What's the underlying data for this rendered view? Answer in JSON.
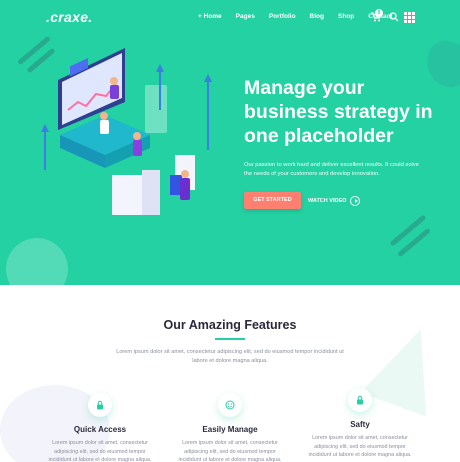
{
  "brand": {
    "logo": ".craxe.",
    "accent": "#23d1a3",
    "cta_color": "#ff8070"
  },
  "nav": {
    "items": [
      "+ Home",
      "Pages",
      "Portfolio",
      "Blog",
      "Shop",
      "Contact"
    ],
    "cart_count": "0",
    "icons": [
      "cart-icon",
      "search-icon",
      "grid-menu-icon"
    ]
  },
  "hero": {
    "title": "Manage your business strategy in one placeholder",
    "subtitle": "Our passion to work hard and deliver excellent results. It could solve the needs of your customers and develop innovation.",
    "cta_label": "GET STARTED",
    "video_label": "WATCH VIDEO"
  },
  "features": {
    "title": "Our Amazing Features",
    "description": "Lorem ipsum dolor sit amet, consectetur adipiscing elit, sed do eiusmod tempor incididunt ut labore et dolore magna aliqua.",
    "cards": [
      {
        "title": "Quick Access",
        "icon": "lock-icon",
        "text": "Lorem ipsum dolor sit amet, consectetur adipiscing elit, sed do eiusmod tempor incididunt ut labore et dolore magna aliqua."
      },
      {
        "title": "Easily Manage",
        "icon": "smile-icon",
        "text": "Lorem ipsum dolor sit amet, consectetur adipiscing elit, sed do eiusmod tempor incididunt ut labore et dolore magna aliqua."
      },
      {
        "title": "Safty",
        "icon": "lock-icon",
        "text": "Lorem ipsum dolor sit amet, consectetur adipiscing elit, sed do eiusmod tempor incididunt ut labore et dolore magna aliqua."
      }
    ]
  }
}
